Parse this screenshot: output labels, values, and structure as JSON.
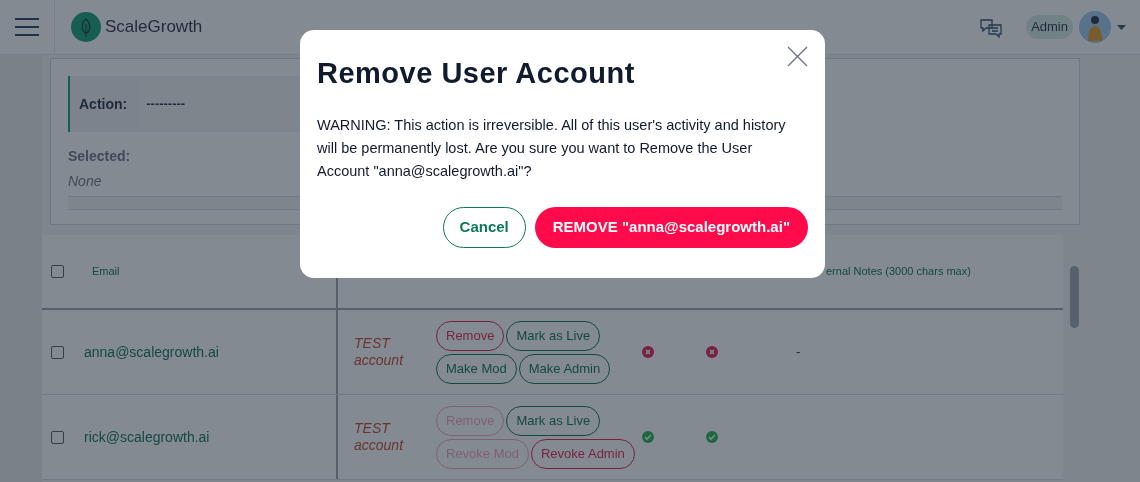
{
  "header": {
    "brand": "ScaleGrowth",
    "user_role": "Admin"
  },
  "filters": {
    "action_label": "Action:",
    "action_value": "---------",
    "selected_label": "Selected:",
    "selected_value": "None"
  },
  "table": {
    "select_all_checked": false,
    "columns": [
      "Email",
      "ernal Notes (3000 chars max)"
    ],
    "rows": [
      {
        "checked": false,
        "email": "anna@scalegrowth.ai",
        "note": "TEST account",
        "actions": [
          [
            {
              "label": "Remove",
              "kind": "danger",
              "disabled": false
            },
            {
              "label": "Mark as Live",
              "kind": "primary",
              "disabled": false
            }
          ],
          [
            {
              "label": "Make Mod",
              "kind": "primary",
              "disabled": false
            },
            {
              "label": "Make Admin",
              "kind": "primary",
              "disabled": false
            }
          ]
        ],
        "flag_1": false,
        "flag_2": false,
        "internal_notes": "-"
      },
      {
        "checked": false,
        "email": "rick@scalegrowth.ai",
        "note": "TEST account",
        "actions": [
          [
            {
              "label": "Remove",
              "kind": "danger",
              "disabled": true
            },
            {
              "label": "Mark as Live",
              "kind": "primary",
              "disabled": false
            }
          ],
          [
            {
              "label": "Revoke Mod",
              "kind": "danger",
              "disabled": true
            },
            {
              "label": "Revoke Admin",
              "kind": "danger",
              "disabled": false
            }
          ]
        ],
        "flag_1": true,
        "flag_2": true
      }
    ]
  },
  "dialog": {
    "title": "Remove User Account",
    "message": "WARNING: This action is irreversible. All of this user's activity and history will be permanently lost. Are you sure you want to Remove the User Account \"anna@scalegrowth.ai\"?",
    "buttons": [
      {
        "label": "Cancel",
        "kind": "secondary"
      },
      {
        "label": "REMOVE \"anna@scalegrowth.ai\"",
        "kind": "danger"
      }
    ]
  }
}
